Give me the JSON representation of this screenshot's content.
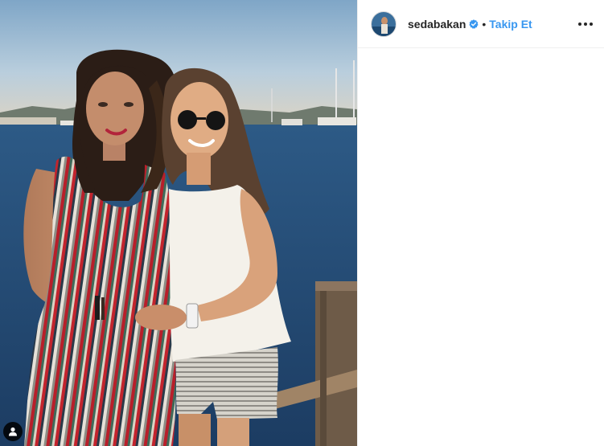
{
  "post": {
    "username": "sedabakan",
    "verified": true,
    "separator": "•",
    "follow_label": "Takip Et",
    "more_icon": "more-options-icon",
    "user_tag_icon": "user-tag-icon"
  },
  "colors": {
    "link_blue": "#3897f0",
    "verified_blue": "#3897f0",
    "text": "#262626",
    "border": "#efefef"
  }
}
